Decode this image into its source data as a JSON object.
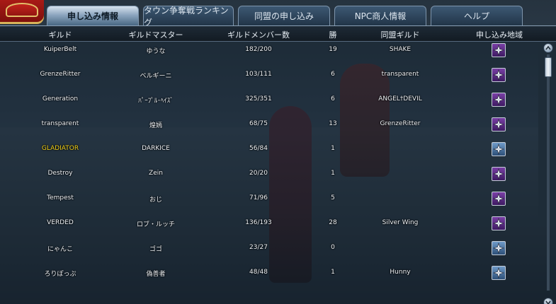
{
  "tabs": [
    {
      "label": "申し込み情報",
      "active": true
    },
    {
      "label": "タウン争奪戦ランキング",
      "active": false
    },
    {
      "label": "同盟の申し込み",
      "active": false
    },
    {
      "label": "NPC商人情報",
      "active": false
    },
    {
      "label": "ヘルプ",
      "active": false
    }
  ],
  "table": {
    "headers": {
      "guild": "ギルド",
      "master": "ギルドマスター",
      "members": "ギルドメンバー数",
      "wins": "勝",
      "ally": "同盟ギルド",
      "area": "申し込み地域"
    },
    "rows": [
      {
        "guild": "KuiperBelt",
        "master": "ゆうな",
        "members": "182/200",
        "wins": "19",
        "ally": "SHAKE",
        "area_icon": "purple"
      },
      {
        "guild": "GrenzeRitter",
        "master": "ベルギーニ",
        "members": "103/111",
        "wins": "6",
        "ally": "transparent",
        "area_icon": "purple"
      },
      {
        "guild": "Generation",
        "master": "ﾊﾟｰﾌﾟﾙ･ﾍｲｽﾞ",
        "members": "325/351",
        "wins": "6",
        "ally": "ANGEL†DEVIL",
        "area_icon": "purple"
      },
      {
        "guild": "transparent",
        "master": "煌嫣",
        "members": "68/75",
        "wins": "13",
        "ally": "GrenzeRitter",
        "area_icon": "purple"
      },
      {
        "guild": "GLADIATOR",
        "master": "DARKICE",
        "members": "56/84",
        "wins": "1",
        "ally": "",
        "area_icon": "blue",
        "highlight": true
      },
      {
        "guild": "Destroy",
        "master": "Zein",
        "members": "20/20",
        "wins": "1",
        "ally": "",
        "area_icon": "purple"
      },
      {
        "guild": "Tempest",
        "master": "おじ",
        "members": "71/96",
        "wins": "5",
        "ally": "",
        "area_icon": "purple"
      },
      {
        "guild": "VERDED",
        "master": "ロブ・ルッチ",
        "members": "136/193",
        "wins": "28",
        "ally": "Silver  Wing",
        "area_icon": "purple"
      },
      {
        "guild": "にゃんこ",
        "master": "ゴゴ",
        "members": "23/27",
        "wins": "0",
        "ally": "",
        "area_icon": "blue"
      },
      {
        "guild": "ろりぽっぷ",
        "master": "偽善者",
        "members": "48/48",
        "wins": "1",
        "ally": "Hunny",
        "area_icon": "blue"
      }
    ]
  },
  "colors": {
    "purple_button": "#5a2a86",
    "blue_button": "#3a6594",
    "highlight_text": "#f2d21a"
  }
}
